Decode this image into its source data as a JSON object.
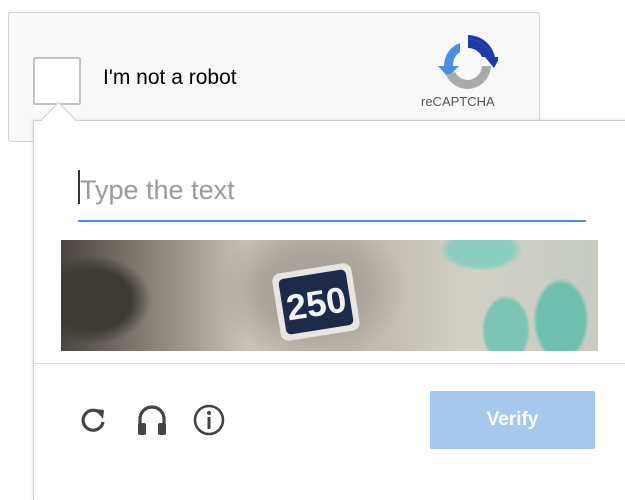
{
  "anchor": {
    "label": "I'm not a robot",
    "brand": "reCAPTCHA",
    "logo_icon": "recaptcha-logo-icon"
  },
  "challenge": {
    "input_placeholder": "Type the text",
    "input_value": "",
    "captcha_text": "250"
  },
  "toolbar": {
    "reload_icon": "reload-icon",
    "audio_icon": "headphones-icon",
    "info_icon": "info-icon",
    "verify_label": "Verify"
  },
  "colors": {
    "accent_blue": "#4a90e2",
    "verify_disabled": "#a6c8ec",
    "logo_blue": "#1c3aa9",
    "logo_light_blue": "#4a90e2",
    "logo_gray": "#aaaaaa"
  }
}
